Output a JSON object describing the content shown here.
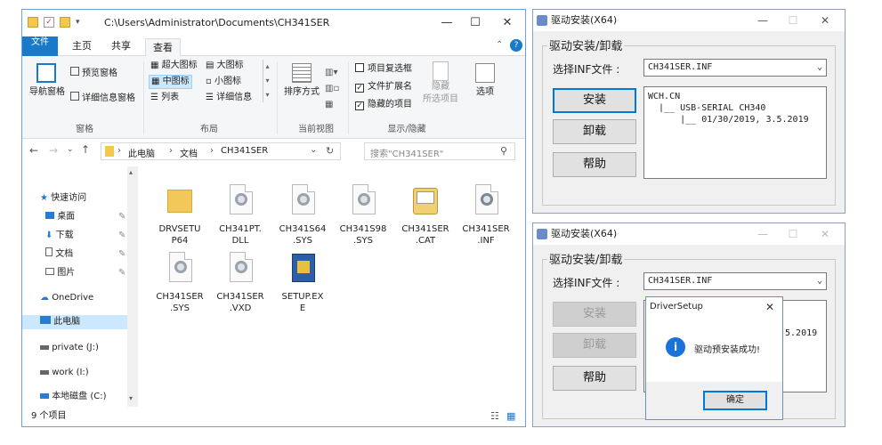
{
  "explorer": {
    "title_path": "C:\\Users\\Administrator\\Documents\\CH341SER",
    "window_buttons": [
      "—",
      "☐",
      "✕"
    ],
    "tabs": {
      "file": "文件",
      "home": "主页",
      "share": "共享",
      "view": "查看"
    },
    "ribbon": {
      "pane_group": {
        "nav_pane": "导航窗格",
        "preview": "预览窗格",
        "details": "详细信息窗格",
        "label": "窗格"
      },
      "layout_group": {
        "xl_icons": "超大图标",
        "l_icons": "大图标",
        "m_icons": "中图标",
        "s_icons": "小图标",
        "list": "列表",
        "details": "详细信息",
        "label": "布局"
      },
      "current_view": {
        "sort": "排序方式",
        "label": "当前视图"
      },
      "show_hide": {
        "item_checkboxes": "项目复选框",
        "file_ext": "文件扩展名",
        "hidden_items": "隐藏的项目",
        "hide": "隐藏",
        "hide_sel": "所选项目",
        "options": "选项",
        "label": "显示/隐藏"
      }
    },
    "address": {
      "crumb1": "此电脑",
      "crumb2": "文档",
      "crumb3": "CH341SER",
      "search_placeholder": "搜索\"CH341SER\""
    },
    "nav": {
      "quick_access": "快速访问",
      "desktop": "桌面",
      "downloads": "下载",
      "documents": "文档",
      "pictures": "图片",
      "onedrive": "OneDrive",
      "this_pc": "此电脑",
      "private": "private (J:)",
      "work": "work (I:)",
      "local_disk": "本地磁盘 (C:)"
    },
    "files": [
      {
        "line1": "DRVSETU",
        "line2": "P64"
      },
      {
        "line1": "CH341PT.",
        "line2": "DLL"
      },
      {
        "line1": "CH341S64",
        "line2": ".SYS"
      },
      {
        "line1": "CH341S98",
        "line2": ".SYS"
      },
      {
        "line1": "CH341SER",
        "line2": ".CAT"
      },
      {
        "line1": "CH341SER",
        "line2": ".INF"
      },
      {
        "line1": "CH341SER",
        "line2": ".SYS"
      },
      {
        "line1": "CH341SER",
        "line2": ".VXD"
      },
      {
        "line1": "SETUP.EX",
        "line2": "E"
      }
    ],
    "status": "9 个项目"
  },
  "driver1": {
    "title": "驱动安装(X64)",
    "group": "驱动安装/卸载",
    "inf_label": "选择INF文件 :",
    "inf_value": "CH341SER.INF",
    "install": "安装",
    "uninstall": "卸载",
    "help": "帮助",
    "info_text": "WCH.CN\n  |__ USB-SERIAL CH340\n      |__ 01/30/2019, 3.5.2019"
  },
  "driver2": {
    "title": "驱动安装(X64)",
    "group": "驱动安装/卸载",
    "inf_label": "选择INF文件 :",
    "inf_value": "CH341SER.INF",
    "install": "安装",
    "uninstall": "卸载",
    "help": "帮助",
    "info_partial": ".5.2019"
  },
  "msgbox": {
    "title": "DriverSetup",
    "message": "驱动预安装成功!",
    "ok": "确定"
  },
  "colors": {
    "accent": "#1979ca",
    "selection": "#cce8ff",
    "dialog_bg": "#f0f0f0"
  }
}
